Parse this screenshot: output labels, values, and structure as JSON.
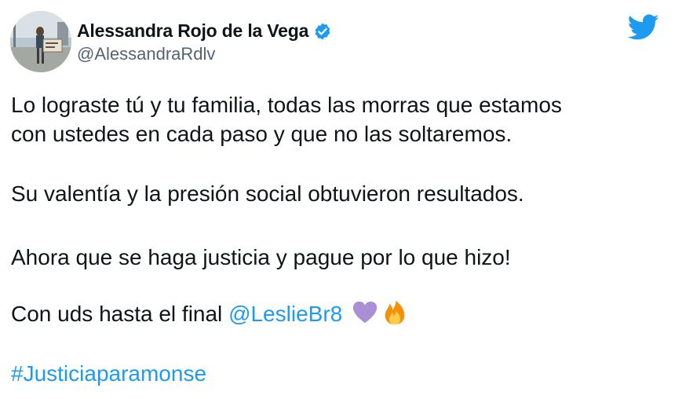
{
  "author": {
    "display_name": "Alessandra Rojo de la Vega",
    "handle": "@AlessandraRdlv",
    "verified": true,
    "verified_icon": "verified-badge-icon",
    "avatar_sign_text": "JUSTICIA"
  },
  "platform_icon": "twitter-bird-icon",
  "tweet": {
    "line1": "Lo lograste tú y tu familia, todas las morras que estamos",
    "line2": "con ustedes en cada paso y que no las soltaremos.",
    "line3": "Su valentía y la presión social obtuvieron resultados.",
    "line4": "Ahora que se haga justicia y pague por lo que hizo!",
    "line5_text": "Con uds hasta el final ",
    "mention": "@LeslieBr8",
    "emojis": [
      "purple-heart-icon",
      "fire-icon"
    ],
    "hashtag": "#Justiciaparamonse"
  },
  "colors": {
    "link": "#1d9bf0",
    "text": "#0f1419",
    "secondary": "#536471"
  }
}
